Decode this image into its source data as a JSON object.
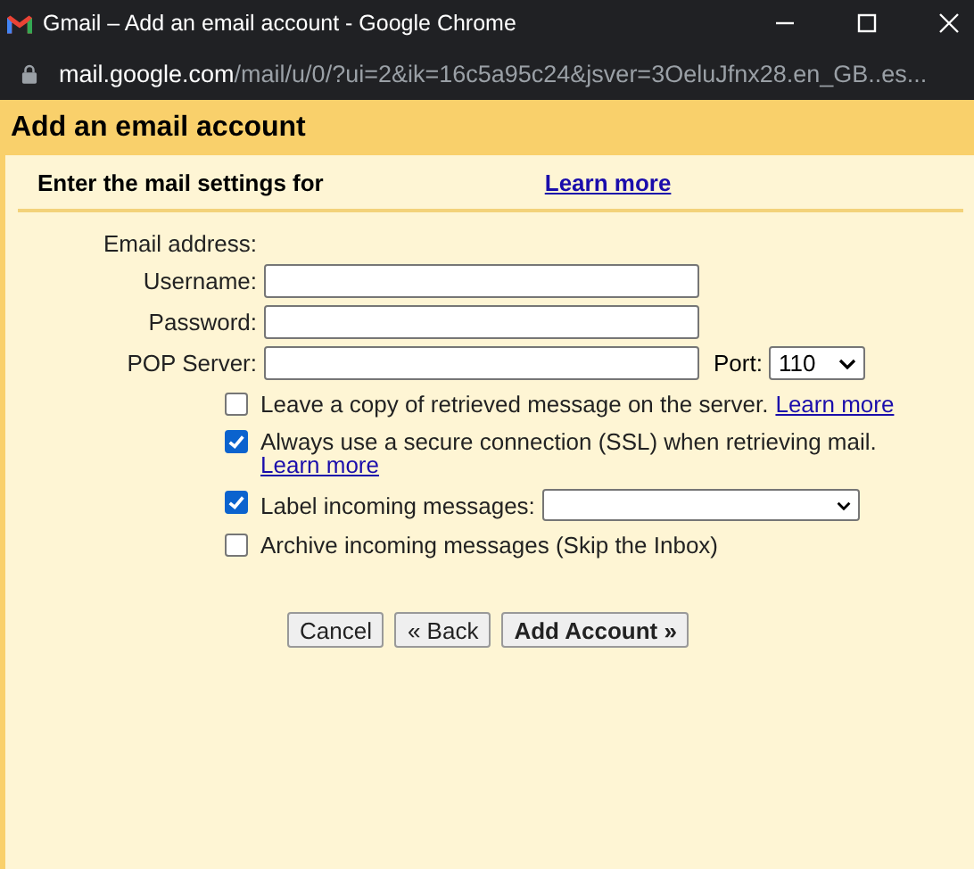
{
  "window": {
    "title": "Gmail – Add an email account - Google Chrome"
  },
  "address_bar": {
    "domain": "mail.google.com",
    "path": "/mail/u/0/?ui=2&ik=16c5a95c24&jsver=3OeluJfnx28.en_GB..es..."
  },
  "page": {
    "title": "Add an email account",
    "intro": "Enter the mail settings for",
    "intro_link": "Learn more"
  },
  "fields": [
    {
      "label": "Email address:",
      "kind": "text"
    },
    {
      "label": "Username:",
      "kind": "input"
    },
    {
      "label": "Password:",
      "kind": "password"
    },
    {
      "label": "POP Server:",
      "kind": "input",
      "port_label": "Port:",
      "port_value": "110"
    }
  ],
  "options": [
    {
      "label": "Leave a copy of retrieved message on the server.",
      "link": "Learn more",
      "checked": false,
      "kind": "inline-link"
    },
    {
      "label": "Always use a secure connection (SSL) when retrieving mail.",
      "link": "Learn more",
      "checked": true,
      "kind": "block-link"
    },
    {
      "label": "Label incoming messages:",
      "checked": true,
      "kind": "select"
    },
    {
      "label": "Archive incoming messages (Skip the Inbox)",
      "checked": false,
      "kind": "plain"
    }
  ],
  "buttons": [
    {
      "label": "Cancel",
      "primary": false
    },
    {
      "label": "« Back",
      "primary": false
    },
    {
      "label": "Add Account »",
      "primary": true
    }
  ]
}
